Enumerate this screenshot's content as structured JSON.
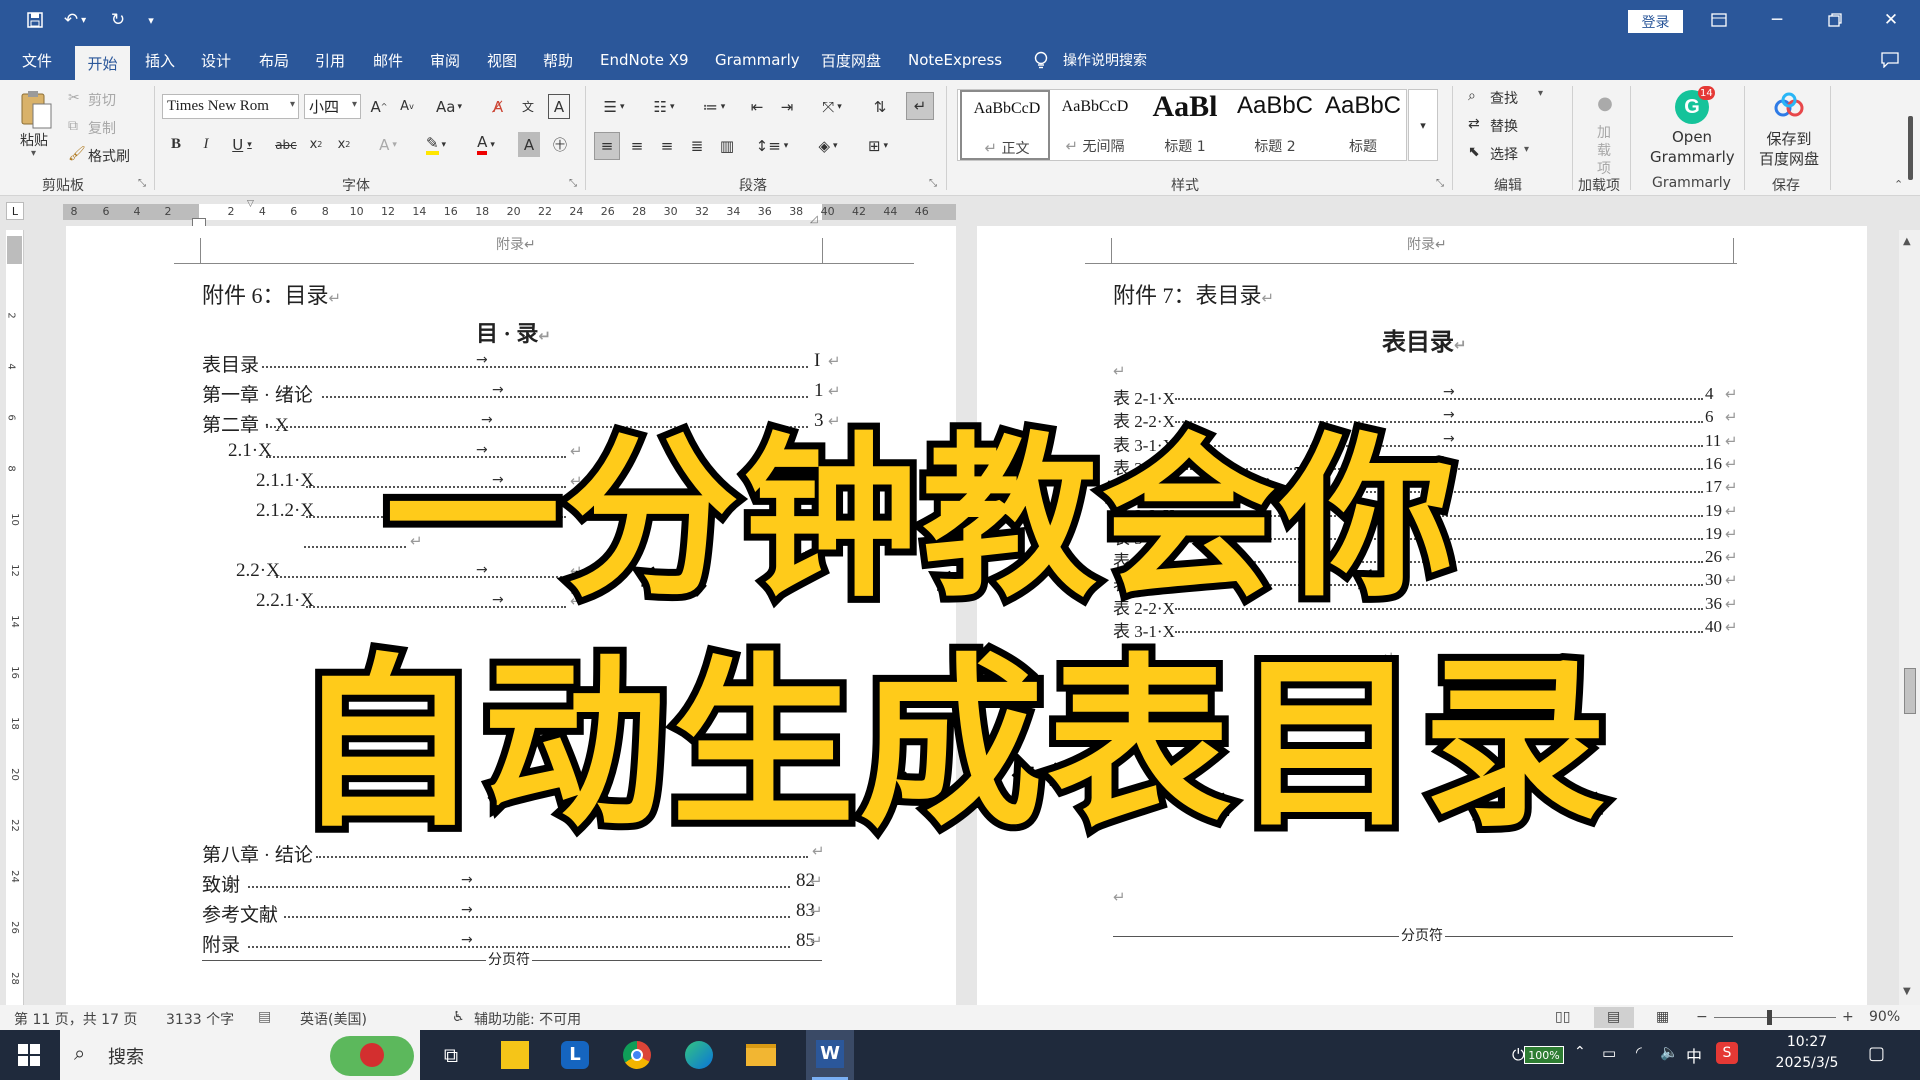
{
  "app": {
    "accent": "#2b579a",
    "login": "登录"
  },
  "menu": [
    "文件",
    "开始",
    "插入",
    "设计",
    "布局",
    "引用",
    "邮件",
    "审阅",
    "视图",
    "帮助",
    "EndNote X9",
    "Grammarly",
    "百度网盘",
    "NoteExpress",
    "操作说明搜索"
  ],
  "ribbon": {
    "clipboard": {
      "paste": "粘贴",
      "cut": "剪切",
      "copy": "复制",
      "format_painter": "格式刷",
      "label": "剪贴板"
    },
    "font": {
      "name": "Times New Rom",
      "size": "小四",
      "label": "字体"
    },
    "paragraph": {
      "label": "段落"
    },
    "styles": {
      "label": "样式",
      "items": [
        {
          "preview": "AaBbCcD",
          "name": "正文",
          "mark": "↵"
        },
        {
          "preview": "AaBbCcD",
          "name": "无间隔",
          "mark": "↵"
        },
        {
          "preview": "AaBl",
          "name": "标题 1"
        },
        {
          "preview": "AaBbC",
          "name": "标题 2"
        },
        {
          "preview": "AaBbC",
          "name": "标题"
        }
      ]
    },
    "editing": {
      "find": "查找",
      "replace": "替换",
      "select": "选择",
      "label": "编辑"
    },
    "addins": {
      "btn": "加载项",
      "label": "加载项"
    },
    "grammarly": {
      "line1": "Open",
      "line2": "Grammarly",
      "label": "Grammarly",
      "badge": "14"
    },
    "save": {
      "line1": "保存到",
      "line2": "百度网盘",
      "label": "保存"
    }
  },
  "ruler": {
    "left": [
      "8",
      "6",
      "4",
      "2"
    ],
    "right": [
      "2",
      "4",
      "6",
      "8",
      "10",
      "12",
      "14",
      "16",
      "18",
      "20",
      "22",
      "24",
      "26",
      "28",
      "30",
      "32",
      "34",
      "36",
      "38",
      "40",
      "42",
      "44",
      "46"
    ]
  },
  "vruler": [
    "2",
    "4",
    "6",
    "8",
    "10",
    "12",
    "14",
    "16",
    "18",
    "20",
    "22",
    "24",
    "26",
    "28",
    "30"
  ],
  "page1": {
    "header": "附录↵",
    "title": "附件 6：目录",
    "toc_title": "目 · 录",
    "entries": [
      {
        "text": "表目录",
        "page": "I"
      },
      {
        "text": "第一章 · 绪论",
        "page": "1"
      },
      {
        "text": "第二章 · X",
        "page": "3"
      },
      {
        "text": "2.1·X",
        "page": ""
      },
      {
        "text": "2.1.1·X",
        "page": ""
      },
      {
        "text": "2.1.2·X",
        "page": ""
      },
      {
        "text": "",
        "page": ""
      },
      {
        "text": "2.2·X",
        "page": ""
      },
      {
        "text": "2.2.1·X",
        "page": ""
      },
      {
        "text": "第八章 · 结论",
        "page": ""
      },
      {
        "text": "致谢",
        "page": "82"
      },
      {
        "text": "参考文献",
        "page": "83"
      },
      {
        "text": "附录",
        "page": "85"
      }
    ],
    "pagebreak": "分页符"
  },
  "page2": {
    "header": "附录↵",
    "title": "附件 7：表目录",
    "toc_title": "表目录",
    "entries": [
      {
        "text": "表 2-1·X",
        "page": "4"
      },
      {
        "text": "表 2-2·X",
        "page": "6"
      },
      {
        "text": "表 3-1·X",
        "page": "11"
      },
      {
        "text": "表 2-2·X",
        "page": "16"
      },
      {
        "text": "表 3-1·X",
        "page": "17"
      },
      {
        "text": "表 3-2·X",
        "page": "19"
      },
      {
        "text": "表 3-1·X",
        "page": "19"
      },
      {
        "text": "表 2-2·X",
        "page": "26"
      },
      {
        "text": "表 3-1·X",
        "page": "30"
      },
      {
        "text": "表 2-2·X",
        "page": "36"
      },
      {
        "text": "表 3-1·X",
        "page": "40"
      }
    ],
    "pagebreak": "分页符"
  },
  "status": {
    "page": "第 11 页，共 17 页",
    "words": "3133 个字",
    "lang": "英语(美国)",
    "access": "辅助功能: 不可用",
    "zoom": "90%"
  },
  "taskbar": {
    "search": "搜索",
    "battery": "100%",
    "time": "10:27",
    "date": "2025/3/5",
    "ime": "中"
  },
  "overlay": {
    "line1": "一分钟教会你",
    "line2": "自动生成表目录"
  }
}
